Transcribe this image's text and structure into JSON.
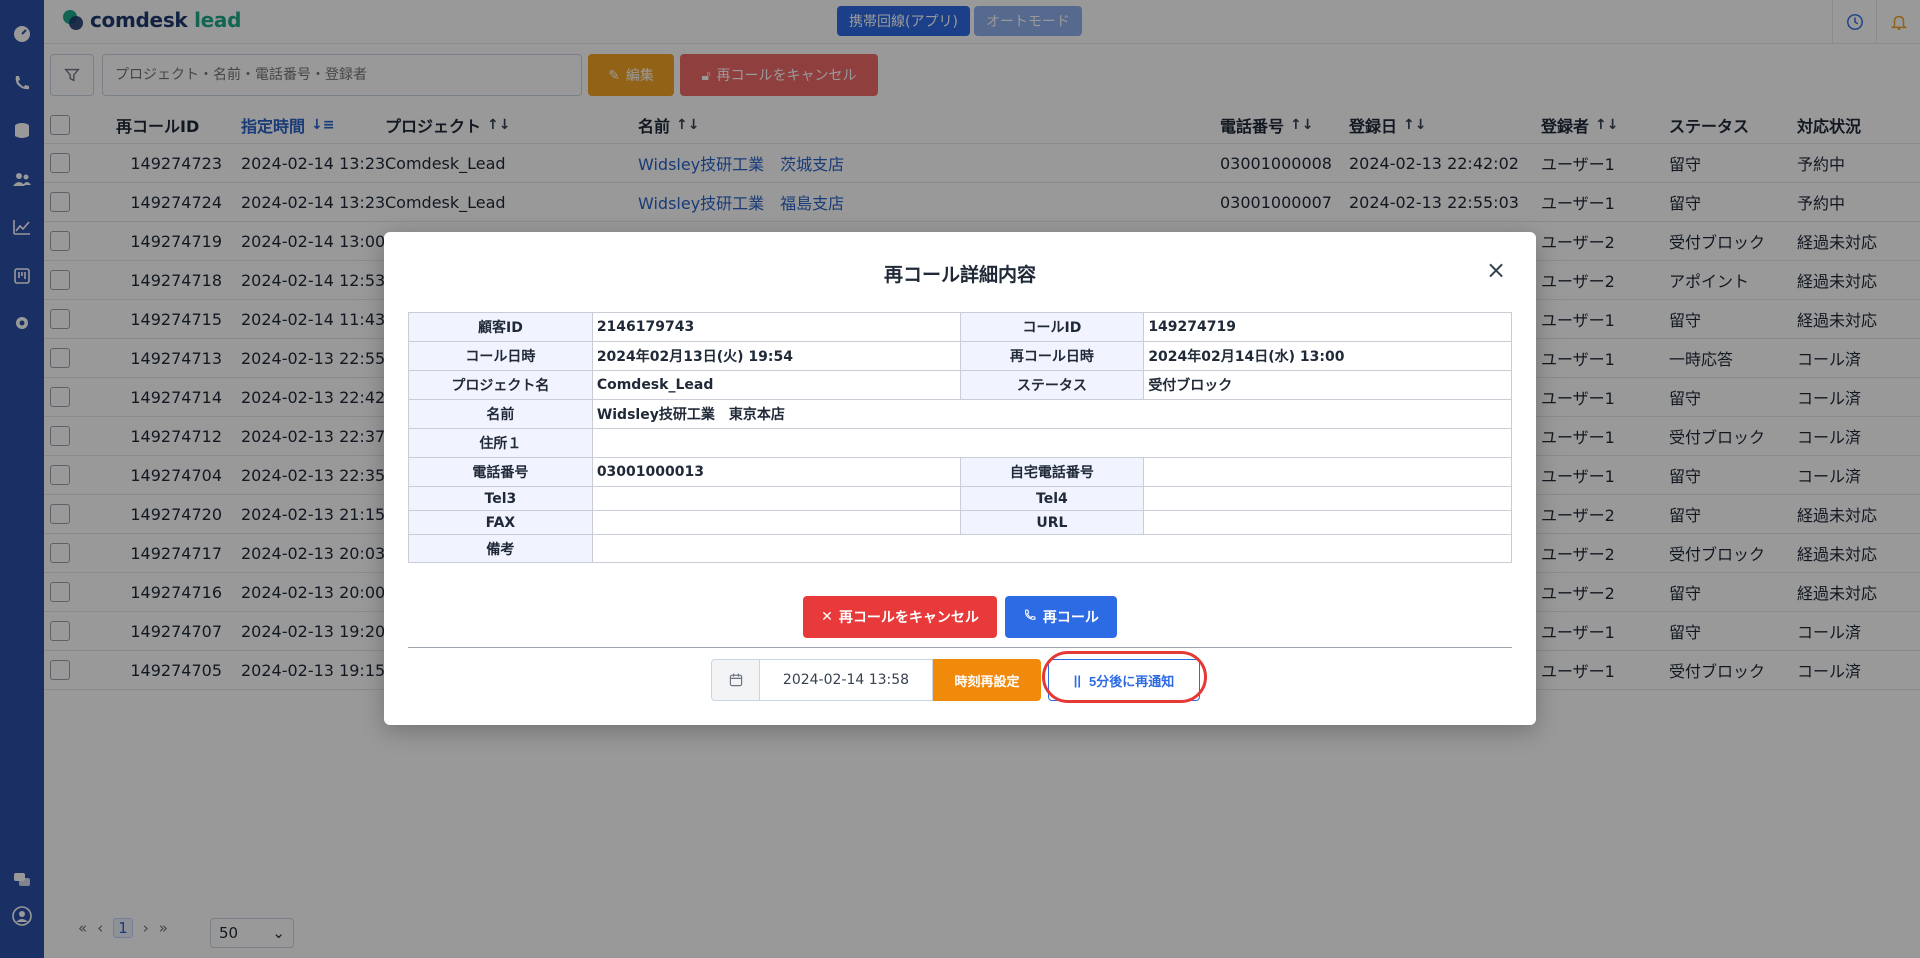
{
  "topbar": {
    "logo_main": "comdesk",
    "logo_sub": "lead",
    "mode_primary": "携帯回線(アプリ)",
    "mode_secondary": "オートモード"
  },
  "toolbar": {
    "search_placeholder": "プロジェクト・名前・電話番号・登録者",
    "edit_label": "編集",
    "cancel_label": "再コールをキャンセル"
  },
  "table": {
    "headers": {
      "id": "再コールID",
      "time": "指定時間",
      "project": "プロジェクト",
      "name": "名前",
      "phone": "電話番号",
      "regdate": "登録日",
      "user": "登録者",
      "status": "ステータス",
      "state": "対応状況"
    },
    "rows": [
      {
        "id": "149274723",
        "time": "2024-02-14 13:23",
        "project": "Comdesk_Lead",
        "name": "Widsley技研工業　茨城支店",
        "phone": "03001000008",
        "regdate": "2024-02-13 22:42:02",
        "user": "ユーザー1",
        "status": "留守",
        "state": "予約中"
      },
      {
        "id": "149274724",
        "time": "2024-02-14 13:23",
        "project": "Comdesk_Lead",
        "name": "Widsley技研工業　福島支店",
        "phone": "03001000007",
        "regdate": "2024-02-13 22:55:03",
        "user": "ユーザー1",
        "status": "留守",
        "state": "予約中"
      },
      {
        "id": "149274719",
        "time": "2024-02-14 13:00",
        "user": "ユーザー2",
        "status": "受付ブロック",
        "state": "経過未対応"
      },
      {
        "id": "149274718",
        "time": "2024-02-14 12:53",
        "user": "ユーザー2",
        "status": "アポイント",
        "state": "経過未対応"
      },
      {
        "id": "149274715",
        "time": "2024-02-14 11:43",
        "user": "ユーザー1",
        "status": "留守",
        "state": "経過未対応"
      },
      {
        "id": "149274713",
        "time": "2024-02-13 22:55",
        "user": "ユーザー1",
        "status": "一時応答",
        "state": "コール済"
      },
      {
        "id": "149274714",
        "time": "2024-02-13 22:42",
        "user": "ユーザー1",
        "status": "留守",
        "state": "コール済"
      },
      {
        "id": "149274712",
        "time": "2024-02-13 22:37",
        "user": "ユーザー1",
        "status": "受付ブロック",
        "state": "コール済"
      },
      {
        "id": "149274704",
        "time": "2024-02-13 22:35",
        "user": "ユーザー1",
        "status": "留守",
        "state": "コール済"
      },
      {
        "id": "149274720",
        "time": "2024-02-13 21:15",
        "user": "ユーザー2",
        "status": "留守",
        "state": "経過未対応"
      },
      {
        "id": "149274717",
        "time": "2024-02-13 20:03",
        "user": "ユーザー2",
        "status": "受付ブロック",
        "state": "経過未対応"
      },
      {
        "id": "149274716",
        "time": "2024-02-13 20:00",
        "user": "ユーザー2",
        "status": "留守",
        "state": "経過未対応"
      },
      {
        "id": "149274707",
        "time": "2024-02-13 19:20",
        "user": "ユーザー1",
        "status": "留守",
        "state": "コール済"
      },
      {
        "id": "149274705",
        "time": "2024-02-13 19:15",
        "user": "ユーザー1",
        "status": "受付ブロック",
        "state": "コール済"
      }
    ]
  },
  "pager": {
    "first": "«",
    "prev": "‹",
    "page": "1",
    "next": "›",
    "last": "»",
    "page_size": "50"
  },
  "modal": {
    "title": "再コール詳細内容",
    "close": "×",
    "labels": {
      "customer_id": "顧客ID",
      "call_id": "コールID",
      "call_datetime": "コール日時",
      "recall_datetime": "再コール日時",
      "project_name": "プロジェクト名",
      "status": "ステータス",
      "name": "名前",
      "address1": "住所１",
      "phone": "電話番号",
      "home_phone": "自宅電話番号",
      "tel3": "Tel3",
      "tel4": "Tel4",
      "fax": "FAX",
      "url": "URL",
      "memo": "備考"
    },
    "values": {
      "customer_id": "2146179743",
      "call_id": "149274719",
      "call_datetime": "2024年02月13日(火) 19:54",
      "recall_datetime": "2024年02月14日(水) 13:00",
      "project_name": "Comdesk_Lead",
      "status": "受付ブロック",
      "name": "Widsley技研工業　東京本店",
      "address1": "",
      "phone": "03001000013",
      "home_phone": "",
      "tel3": "",
      "tel4": "",
      "fax": "",
      "url": "",
      "memo": ""
    },
    "cancel_label": "再コールをキャンセル",
    "recall_label": "再コール",
    "reschedule_date": "2024-02-14 13:58",
    "reset_label": "時刻再設定",
    "notify_label": "5分後に再通知"
  },
  "colors": {
    "sidebar": "#2c4fa6",
    "primary": "#2d6be4",
    "danger": "#e83a3a",
    "warning": "#f18a0a",
    "highlight": "#e53935"
  }
}
